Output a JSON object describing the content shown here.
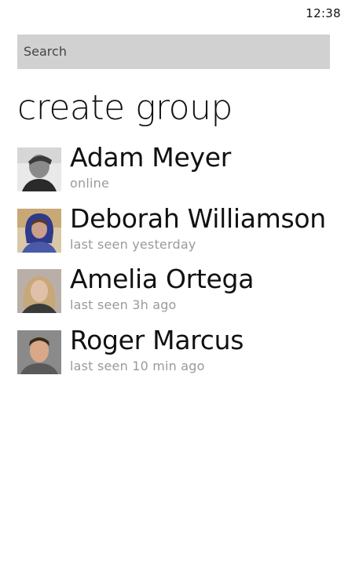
{
  "status_bar": {
    "time": "12:38"
  },
  "search": {
    "placeholder": "Search"
  },
  "page": {
    "title": "create group"
  },
  "contacts": [
    {
      "name": "Adam Meyer",
      "status": "online",
      "avatar_icon": "user-photo"
    },
    {
      "name": "Deborah Williamson",
      "status": "last seen yesterday",
      "avatar_icon": "user-photo"
    },
    {
      "name": "Amelia Ortega",
      "status": "last seen 3h ago",
      "avatar_icon": "user-photo"
    },
    {
      "name": "Roger Marcus",
      "status": "last seen 10 min ago",
      "avatar_icon": "user-photo"
    }
  ],
  "colors": {
    "background": "#ffffff",
    "search_background": "#d1d1d1",
    "status_text": "#9a9a9a",
    "primary_text": "#111111"
  }
}
